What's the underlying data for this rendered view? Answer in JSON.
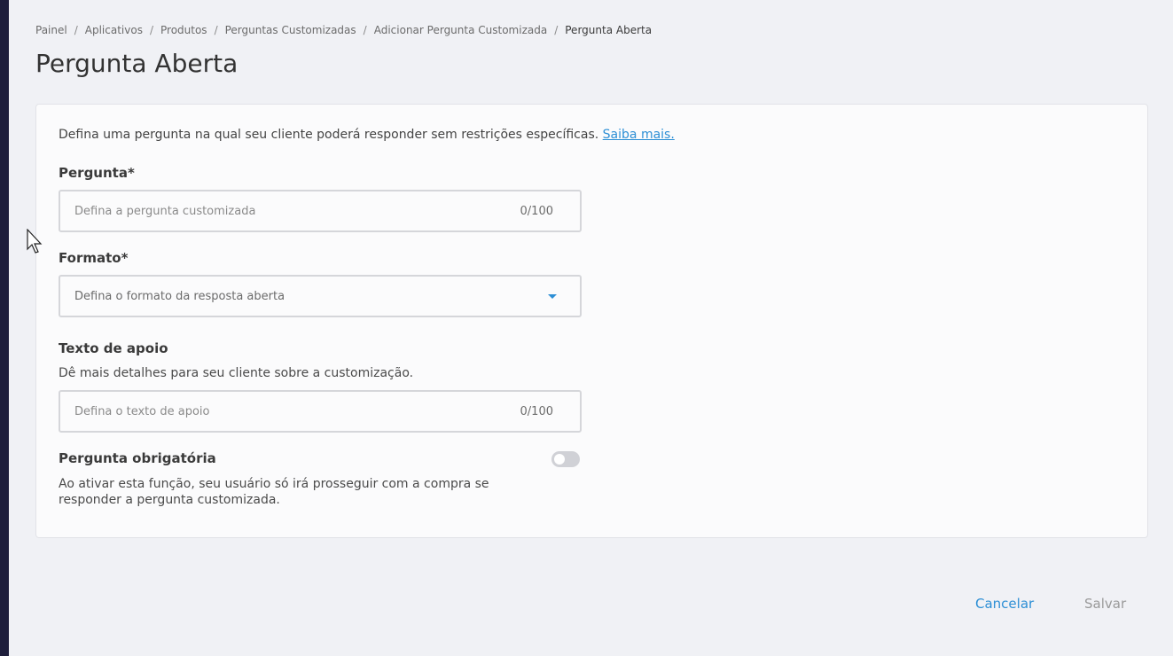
{
  "breadcrumb": [
    {
      "label": "Painel"
    },
    {
      "label": "Aplicativos"
    },
    {
      "label": "Produtos"
    },
    {
      "label": "Perguntas Customizadas"
    },
    {
      "label": "Adicionar Pergunta Customizada"
    },
    {
      "label": "Pergunta Aberta"
    }
  ],
  "page": {
    "title": "Pergunta Aberta"
  },
  "form": {
    "intro": "Defina uma pergunta na qual seu cliente poderá responder sem restrições específicas.",
    "intro_link": "Saiba mais.",
    "question": {
      "label": "Pergunta*",
      "placeholder": "Defina a pergunta customizada",
      "value": "",
      "counter": "0/100"
    },
    "format": {
      "label": "Formato*",
      "placeholder": "Defina o formato da resposta aberta"
    },
    "support_text": {
      "label": "Texto de apoio",
      "help": "Dê mais detalhes para seu cliente sobre a customização.",
      "placeholder": "Defina o texto de apoio",
      "value": "",
      "counter": "0/100"
    },
    "required": {
      "label": "Pergunta obrigatória",
      "help_line1": "Ao ativar esta função, seu usuário só irá prosseguir com a compra se",
      "help_line2": "responder a pergunta customizada.",
      "enabled": false
    }
  },
  "actions": {
    "cancel_label": "Cancelar",
    "save_label": "Salvar"
  },
  "colors": {
    "accent": "#2d8fd5",
    "rail": "#1e1e3c",
    "background": "#f0f1f5"
  }
}
